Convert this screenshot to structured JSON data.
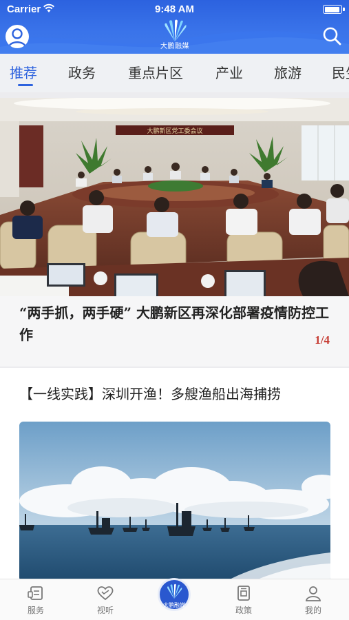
{
  "status_bar": {
    "carrier": "Carrier",
    "time": "9:48 AM"
  },
  "app": {
    "logo_text": "大鹏融媒"
  },
  "tabs": [
    {
      "label": "推荐",
      "active": true
    },
    {
      "label": "政务"
    },
    {
      "label": "重点片区"
    },
    {
      "label": "产业"
    },
    {
      "label": "旅游"
    },
    {
      "label": "民生"
    }
  ],
  "featured": {
    "caption": "“两手抓，两手硬” 大鹏新区再深化部署疫情防控工作",
    "pager": "1/4",
    "banner_text": "大鹏新区党工委会议"
  },
  "article": {
    "title": "【一线实践】深圳开渔！多艘渔船出海捕捞"
  },
  "bottom_nav": {
    "items": [
      {
        "label": "服务"
      },
      {
        "label": "视听"
      },
      {
        "label": "大鹏融媒"
      },
      {
        "label": "政策"
      },
      {
        "label": "我的"
      }
    ]
  },
  "colors": {
    "brand_blue": "#2e63de",
    "pager_red": "#c63b32"
  }
}
